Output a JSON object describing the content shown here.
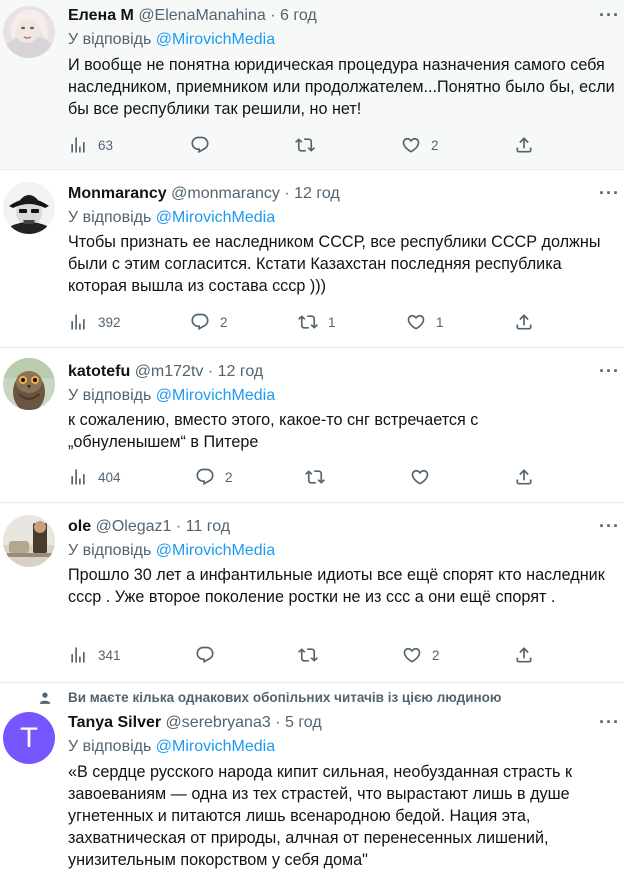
{
  "reply_prefix": "У відповідь",
  "mention": "@MirovichMedia",
  "tweets": [
    {
      "name": "Елена М",
      "handle": "@ElenaManahina",
      "time": "6 год",
      "text": "И вообще не понятна юридическая процедура назначения самого себя наследником, приемником или продолжателем...Понятно было бы, если бы все республики так решили, но нет!",
      "views": "63",
      "replies": "",
      "retweets": "",
      "likes": "2"
    },
    {
      "name": "Monmarancy",
      "handle": "@monmarancy",
      "time": "12 год",
      "text": "Чтобы признать ее наследником СССР, все республики СССР должны были с этим согласится. Кстати Казахстан последняя республика которая вышла из состава ссср )))",
      "views": "392",
      "replies": "2",
      "retweets": "1",
      "likes": "1"
    },
    {
      "name": "katotefu",
      "handle": "@m172tv",
      "time": "12 год",
      "text": "к сожалению, вместо этого, какое-то снг встречается с „обнуленышем“ в Питере",
      "views": "404",
      "replies": "2",
      "retweets": "",
      "likes": ""
    },
    {
      "name": "ole",
      "handle": "@Olegaz1",
      "time": "11 год",
      "text": "Прошло 30 лет а инфантильные идиоты все ещё спорят кто наследник ссср . Уже второе поколение ростки не из ссс а они ещё спорят .",
      "views": "341",
      "replies": "",
      "retweets": "",
      "likes": "2"
    },
    {
      "social_context": "Ви маєте кілька однакових обопільних читачів із цією людиною",
      "avatar_letter": "T",
      "name": "Tanya Silver",
      "handle": "@serebryana3",
      "time": "5 год",
      "text": "«В сердце русского народа кипит сильная, необузданная страсть к завоеваниям — одна из тех страстей, что вырастают лишь в душе угнетенных и питаются лишь всенародною бедой. Нация эта, захватническая от природы, алчная от перенесенных лишений, унизительным покорством у себя дома\""
    }
  ],
  "colors": {
    "link": "#1d9bf0",
    "secondary": "#536471",
    "avatar_tanya": "#7856ff"
  },
  "icons": [
    "views-icon",
    "reply-icon",
    "retweet-icon",
    "like-icon",
    "share-icon",
    "more-icon",
    "person-icon"
  ]
}
